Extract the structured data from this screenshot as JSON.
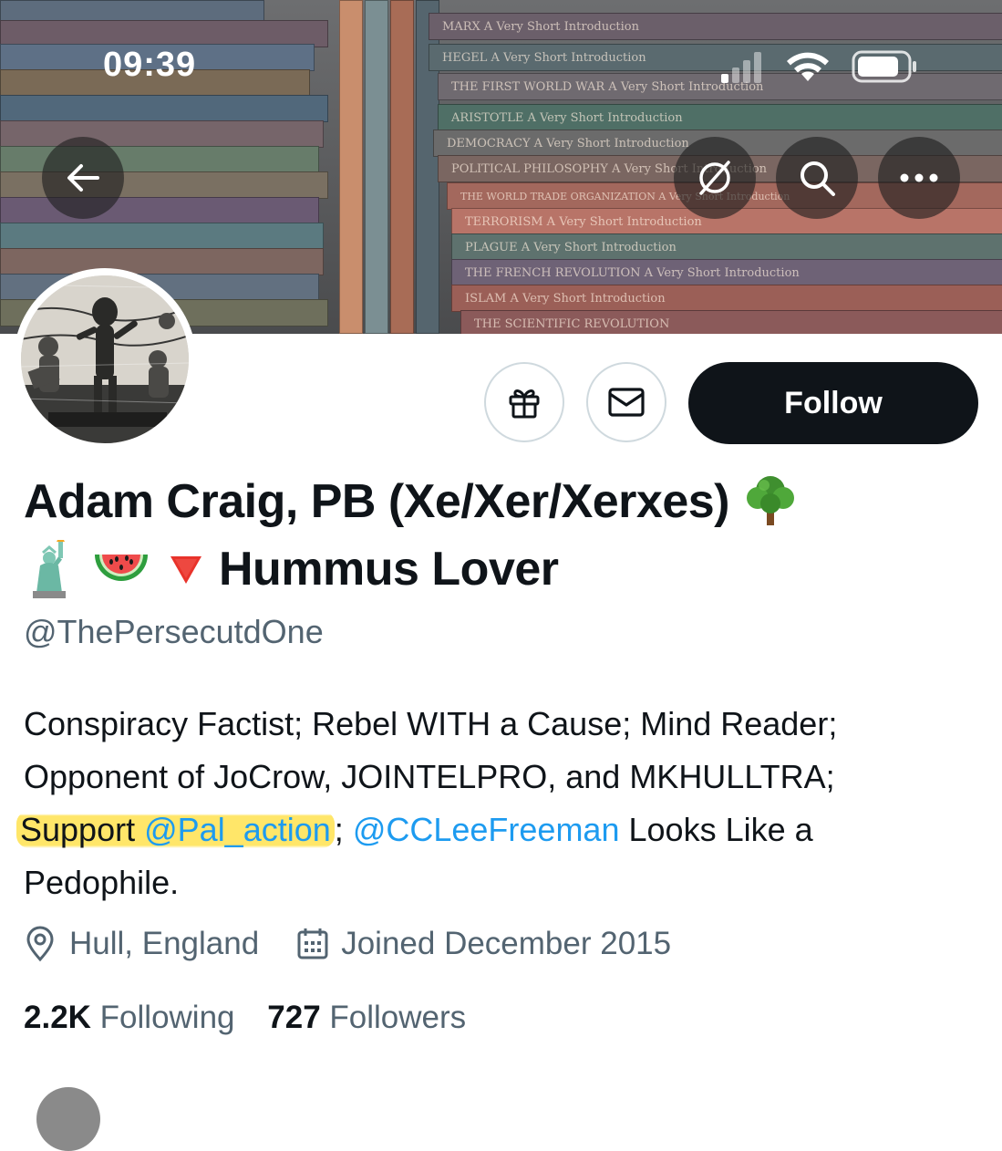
{
  "status_bar": {
    "time": "09:39"
  },
  "banner": {
    "books": [
      "MARX A Very Short Introduction",
      "HEGEL A Very Short Introduction",
      "THE FIRST WORLD WAR A Very Short Introduction",
      "ARISTOTLE A Very Short Introduction",
      "DEMOCRACY A Very Short Introduction",
      "POLITICAL PHILOSOPHY A Very Short Introduction",
      "THE WORLD TRADE ORGANIZATION A Very Short Introduction",
      "TERRORISM A Very Short Introduction",
      "PLAGUE A Very Short Introduction",
      "THE FRENCH REVOLUTION A Very Short Introduction",
      "ISLAM A Very Short Introduction",
      "THE SCIENTIFIC REVOLUTION"
    ]
  },
  "nav": {
    "back_icon": "arrow-left-icon",
    "translate_icon": "translate-off-icon",
    "search_icon": "search-icon",
    "more_icon": "more-icon"
  },
  "actions": {
    "gift_icon": "gift-icon",
    "message_icon": "mail-icon",
    "follow_label": "Follow"
  },
  "profile": {
    "name_line1": "Adam Craig, PB (Xe/Xer/Xerxes)",
    "name_line2_text": "Hummus Lover",
    "handle": "@ThePersecutdOne",
    "bio": {
      "line1": "Conspiracy Factist; Rebel WITH a Cause; Mind Reader;",
      "line2": "Opponent of JoCrow, JOINTELPRO, and MKHULLTRA;",
      "line3_support": "Support",
      "line3_mention1": "@Pal_action",
      "line3_sep": ";",
      "line3_mention2": "@CCLeeFreeman",
      "line3_tail": "Looks Like a",
      "line4": "Pedophile."
    },
    "location": "Hull, England",
    "joined": "Joined December 2015"
  },
  "stats": {
    "following_count": "2.2K",
    "following_label": "Following",
    "followers_count": "727",
    "followers_label": "Followers"
  },
  "colors": {
    "text": "#0f1419",
    "secondary": "#536471",
    "link": "#1d9bf0",
    "highlight": "#ffe45c"
  }
}
